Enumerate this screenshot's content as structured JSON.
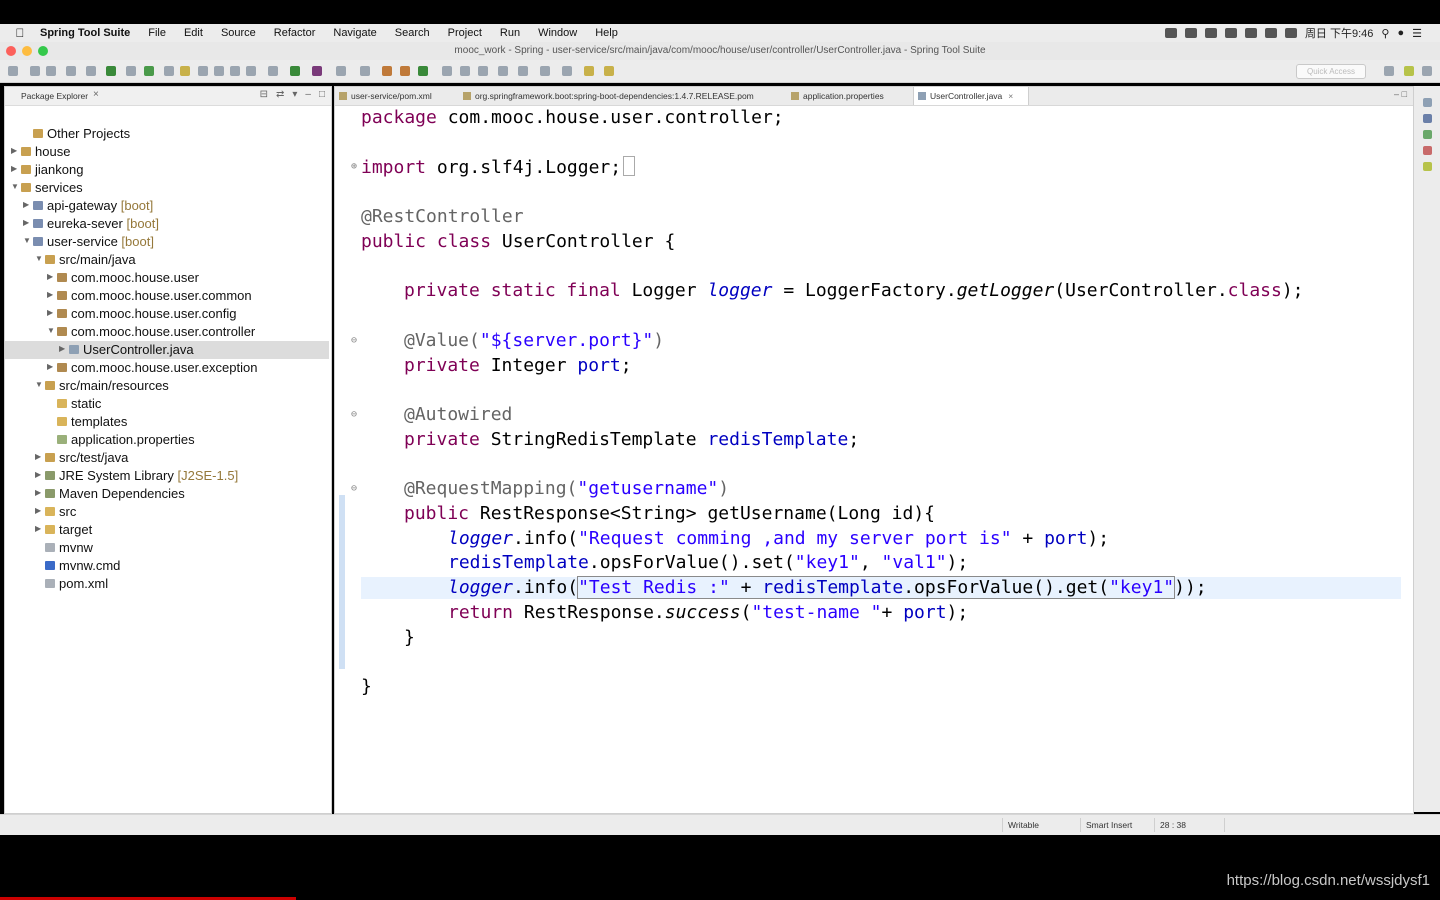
{
  "menubar": {
    "app_name": "Spring Tool Suite",
    "items": [
      "File",
      "Edit",
      "Source",
      "Refactor",
      "Navigate",
      "Search",
      "Project",
      "Run",
      "Window",
      "Help"
    ],
    "clock": "周日 下午9:46"
  },
  "window": {
    "title": "mooc_work - Spring - user-service/src/main/java/com/mooc/house/user/controller/UserController.java - Spring Tool Suite"
  },
  "toolbar": {
    "quick_access_placeholder": "Quick Access"
  },
  "package_explorer": {
    "title": "Package Explorer",
    "tree": [
      {
        "label": "Other Projects",
        "suffix": "",
        "depth": 1,
        "icon": "working-set-icon",
        "arrow": ""
      },
      {
        "label": "house",
        "suffix": "",
        "depth": 0,
        "icon": "working-set-icon",
        "arrow": "▶"
      },
      {
        "label": "jiankong",
        "suffix": "",
        "depth": 0,
        "icon": "working-set-icon",
        "arrow": "▶"
      },
      {
        "label": "services",
        "suffix": "",
        "depth": 0,
        "icon": "working-set-icon",
        "arrow": "▼"
      },
      {
        "label": "api-gateway",
        "suffix": " [boot]",
        "depth": 1,
        "icon": "project-icon",
        "arrow": "▶"
      },
      {
        "label": "eureka-sever",
        "suffix": " [boot]",
        "depth": 1,
        "icon": "project-icon",
        "arrow": "▶"
      },
      {
        "label": "user-service",
        "suffix": " [boot]",
        "depth": 1,
        "icon": "project-icon",
        "arrow": "▼"
      },
      {
        "label": "src/main/java",
        "suffix": "",
        "depth": 2,
        "icon": "source-folder-icon",
        "arrow": "▼"
      },
      {
        "label": "com.mooc.house.user",
        "suffix": "",
        "depth": 3,
        "icon": "package-icon",
        "arrow": "▶"
      },
      {
        "label": "com.mooc.house.user.common",
        "suffix": "",
        "depth": 3,
        "icon": "package-icon",
        "arrow": "▶"
      },
      {
        "label": "com.mooc.house.user.config",
        "suffix": "",
        "depth": 3,
        "icon": "package-icon",
        "arrow": "▶"
      },
      {
        "label": "com.mooc.house.user.controller",
        "suffix": "",
        "depth": 3,
        "icon": "package-icon",
        "arrow": "▼"
      },
      {
        "label": "UserController.java",
        "suffix": "",
        "depth": 4,
        "icon": "java-file-icon",
        "arrow": "▶",
        "selected": true
      },
      {
        "label": "com.mooc.house.user.exception",
        "suffix": "",
        "depth": 3,
        "icon": "package-icon",
        "arrow": "▶"
      },
      {
        "label": "src/main/resources",
        "suffix": "",
        "depth": 2,
        "icon": "source-folder-icon",
        "arrow": "▼"
      },
      {
        "label": "static",
        "suffix": "",
        "depth": 3,
        "icon": "folder-icon",
        "arrow": ""
      },
      {
        "label": "templates",
        "suffix": "",
        "depth": 3,
        "icon": "folder-icon",
        "arrow": ""
      },
      {
        "label": "application.properties",
        "suffix": "",
        "depth": 3,
        "icon": "properties-file-icon",
        "arrow": ""
      },
      {
        "label": "src/test/java",
        "suffix": "",
        "depth": 2,
        "icon": "source-folder-icon",
        "arrow": "▶"
      },
      {
        "label": "JRE System Library",
        "suffix": " [J2SE-1.5]",
        "depth": 2,
        "icon": "library-icon",
        "arrow": "▶"
      },
      {
        "label": "Maven Dependencies",
        "suffix": "",
        "depth": 2,
        "icon": "library-icon",
        "arrow": "▶"
      },
      {
        "label": "src",
        "suffix": "",
        "depth": 2,
        "icon": "folder-icon",
        "arrow": "▶"
      },
      {
        "label": "target",
        "suffix": "",
        "depth": 2,
        "icon": "folder-icon",
        "arrow": "▶"
      },
      {
        "label": "mvnw",
        "suffix": "",
        "depth": 2,
        "icon": "file-icon",
        "arrow": ""
      },
      {
        "label": "mvnw.cmd",
        "suffix": "",
        "depth": 2,
        "icon": "cmd-file-icon",
        "arrow": ""
      },
      {
        "label": "pom.xml",
        "suffix": "",
        "depth": 2,
        "icon": "xml-file-icon",
        "arrow": ""
      }
    ]
  },
  "editor": {
    "tabs": [
      {
        "label": "user-service/pom.xml",
        "active": false
      },
      {
        "label": "org.springframework.boot:spring-boot-dependencies:1.4.7.RELEASE.pom",
        "active": false
      },
      {
        "label": "application.properties",
        "active": false
      },
      {
        "label": "UserController.java",
        "active": true
      }
    ],
    "code": {
      "package_kw": "package",
      "package_name": " com.mooc.house.user.controller;",
      "import_kw": "import",
      "import_name": " org.slf4j.Logger;",
      "ann_rest": "@RestController",
      "class_kw": "public class",
      "class_name": " UserController {",
      "logger_kw": "private static final",
      "logger_type": " Logger ",
      "logger_field": "logger",
      "logger_rest_a": " = LoggerFactory.",
      "logger_method": "getLogger",
      "logger_rest_b": "(UserController.",
      "logger_class_kw": "class",
      "logger_rest_c": ");",
      "ann_value": "@Value(",
      "ann_value_str": "\"${server.port}\"",
      "ann_value_end": ")",
      "port_kw": "private",
      "port_type": " Integer ",
      "port_field": "port",
      "port_end": ";",
      "ann_autowired": "@Autowired",
      "redis_kw": "private",
      "redis_type": " StringRedisTemplate ",
      "redis_field": "redisTemplate",
      "redis_end": ";",
      "ann_mapping": "@RequestMapping(",
      "ann_mapping_str": "\"getusername\"",
      "ann_mapping_end": ")",
      "method_kw": "public",
      "method_sig": " RestResponse<String> getUsername(Long id){",
      "l1_logger": "logger",
      "l1_a": ".info(",
      "l1_str": "\"Request comming ,and my server port is\"",
      "l1_b": " + ",
      "l1_port": "port",
      "l1_c": ");",
      "l2_redis": "redisTemplate",
      "l2_a": ".opsForValue().set(",
      "l2_s1": "\"key1\"",
      "l2_b": ", ",
      "l2_s2": "\"val1\"",
      "l2_c": ");",
      "l3_logger": "logger",
      "l3_a": ".info(",
      "l3_str": "\"Test Redis :\"",
      "l3_b": " + ",
      "l3_redis": "redisTemplate",
      "l3_c": ".opsForValue().get(",
      "l3_s1": "\"key1\"",
      "l3_d": ")",
      "l3_e": ");",
      "ret_kw": "return",
      "ret_a": " RestResponse.",
      "ret_method": "success",
      "ret_b": "(",
      "ret_str": "\"test-name \"",
      "ret_c": "+ ",
      "ret_port": "port",
      "ret_d": ");",
      "close_method": "}",
      "close_class": "}"
    }
  },
  "statusbar": {
    "mode": "Writable",
    "insert": "Smart Insert",
    "position": "28 : 38"
  },
  "watermark": "https://blog.csdn.net/wssjdysf1",
  "colors": {
    "keyword": "#7f0055",
    "string": "#2a00ff",
    "field": "#0000c0",
    "annotation": "#646464",
    "current_line": "#e8f2fe",
    "selected_row": "#dcdcdc"
  }
}
